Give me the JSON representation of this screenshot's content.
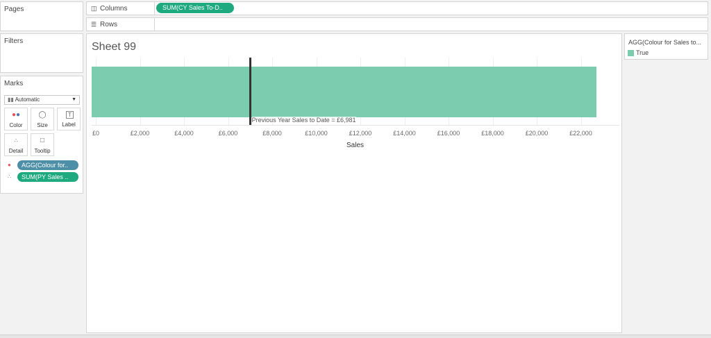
{
  "pages": {
    "title": "Pages"
  },
  "filters": {
    "title": "Filters"
  },
  "marks": {
    "title": "Marks",
    "mark_type": "Automatic",
    "buttons": {
      "color": "Color",
      "size": "Size",
      "label": "Label",
      "detail": "Detail",
      "tooltip": "Tooltip"
    },
    "pills": [
      {
        "text": "AGG(Colour for..",
        "icon": "color-dots-icon",
        "color": "#4e8fa8"
      },
      {
        "text": "SUM(PY Sales ..",
        "icon": "detail-icon",
        "color": "#1fa97f"
      }
    ]
  },
  "shelves": {
    "columns_label": "Columns",
    "columns_pill": "SUM(CY Sales To-D..",
    "rows_label": "Rows"
  },
  "sheet": {
    "title": "Sheet 99",
    "reference_label": "Previous Year Sales to Date = £6,981"
  },
  "legend": {
    "title": "AGG(Colour for Sales to...",
    "items": [
      {
        "label": "True",
        "color": "#7ccdb0"
      }
    ]
  },
  "chart_data": {
    "type": "bar",
    "orientation": "horizontal",
    "categories": [
      ""
    ],
    "values": [
      22700
    ],
    "bar_color": "#7ccdb0",
    "xlabel": "Sales",
    "xlim": [
      0,
      23000
    ],
    "ticks": [
      "£0",
      "£2,000",
      "£4,000",
      "£6,000",
      "£8,000",
      "£10,000",
      "£12,000",
      "£14,000",
      "£16,000",
      "£18,000",
      "£20,000",
      "£22,000"
    ],
    "reference_line": {
      "value": 6981,
      "label": "Previous Year Sales to Date = £6,981"
    }
  }
}
